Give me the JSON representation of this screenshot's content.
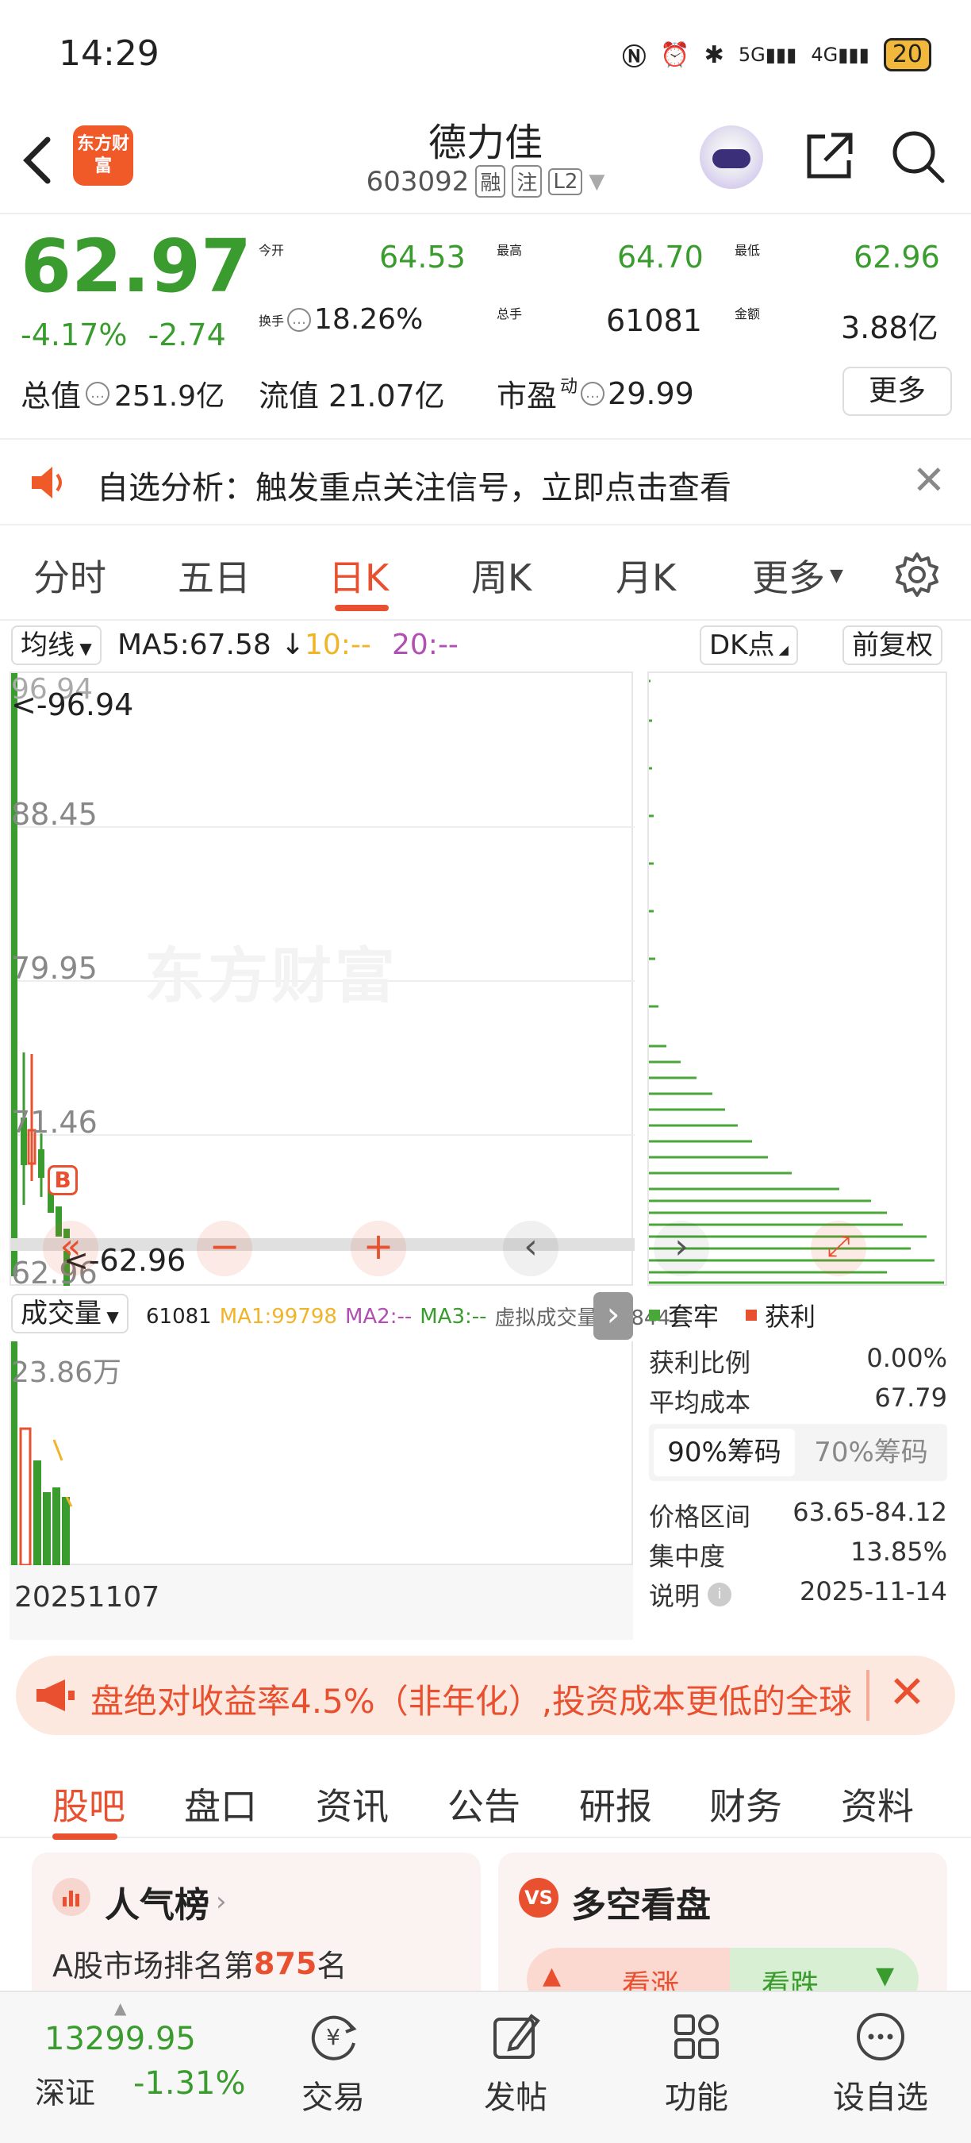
{
  "status_bar": {
    "time": "14:29",
    "network1": "5G",
    "network2": "4G",
    "battery": "20"
  },
  "header": {
    "back_icon": "chevron-left-icon",
    "logo_text": "东方财富",
    "stock_name": "德力佳",
    "stock_code": "603092",
    "tags": [
      "融",
      "注",
      "L2"
    ],
    "share_icon": "share-icon",
    "search_icon": "search-icon"
  },
  "quote": {
    "price": "62.97",
    "change_pct": "-4.17%",
    "change_amt": "-2.74",
    "open_label": "今开",
    "open": "64.53",
    "high_label": "最高",
    "high": "64.70",
    "low_label": "最低",
    "low": "62.96",
    "turnover_label": "换手",
    "turnover": "18.26%",
    "volume_label": "总手",
    "volume": "61081",
    "amount_label": "金额",
    "amount": "3.88亿",
    "mcap_label": "总值",
    "mcap": "251.9亿",
    "float_label": "流值",
    "float": "21.07亿",
    "pe_label": "市盈",
    "pe_sup": "动",
    "pe": "29.99",
    "more_label": "更多",
    "colors": {
      "down": "#3a9c2e",
      "up": "#e8502f"
    }
  },
  "alert": {
    "text": "自选分析：触发重点关注信号，立即点击查看"
  },
  "period_tabs": {
    "items": [
      "分时",
      "五日",
      "日K",
      "周K",
      "月K",
      "更多"
    ],
    "active": "日K"
  },
  "indicators": {
    "ma_select": "均线",
    "ma5": "MA5:67.58",
    "ma10": "10:--",
    "ma20": "20:--",
    "dk_label": "DK点",
    "adjust_label": "前复权"
  },
  "kline": {
    "y_labels": [
      "96.94",
      "88.45",
      "79.95",
      "71.46",
      "62.96"
    ],
    "high_marker": "<-96.94",
    "low_marker": "<-62.96",
    "b_marker": "B",
    "watermark": "东方财富"
  },
  "volume": {
    "select_label": "成交量",
    "vol_value": "61081",
    "ma1": "MA1:99798",
    "ma2": "MA2:--",
    "ma3": "MA3:--",
    "virtual": "虚拟成交量:77844",
    "max_label": "23.86万",
    "date": "20251107"
  },
  "chip": {
    "legend_trapped": "套牢",
    "legend_profit": "获利",
    "profit_ratio_label": "获利比例",
    "profit_ratio": "0.00%",
    "avg_cost_label": "平均成本",
    "avg_cost": "67.79",
    "tab_90": "90%筹码",
    "tab_70": "70%筹码",
    "range_label": "价格区间",
    "range": "63.65-84.12",
    "concentration_label": "集中度",
    "concentration": "13.85%",
    "note_label": "说明",
    "note_date": "2025-11-14"
  },
  "banner": {
    "text": "盘绝对收益率4.5%（非年化）,投资成本更低的全球"
  },
  "bottom_tabs": {
    "items": [
      "股吧",
      "盘口",
      "资讯",
      "公告",
      "研报",
      "财务",
      "资料"
    ],
    "active": "股吧"
  },
  "cards": {
    "popularity_title": "人气榜",
    "popularity_text_prefix": "A股市场排名第",
    "popularity_rank": "875",
    "popularity_text_suffix": "名",
    "vs_title": "多空看盘",
    "bull_label": "看涨",
    "bear_label": "看跌"
  },
  "bottom_nav": {
    "index_value": "13299.95",
    "index_name": "深证",
    "index_change": "-1.31%",
    "items": [
      "交易",
      "发帖",
      "功能",
      "设自选"
    ]
  }
}
